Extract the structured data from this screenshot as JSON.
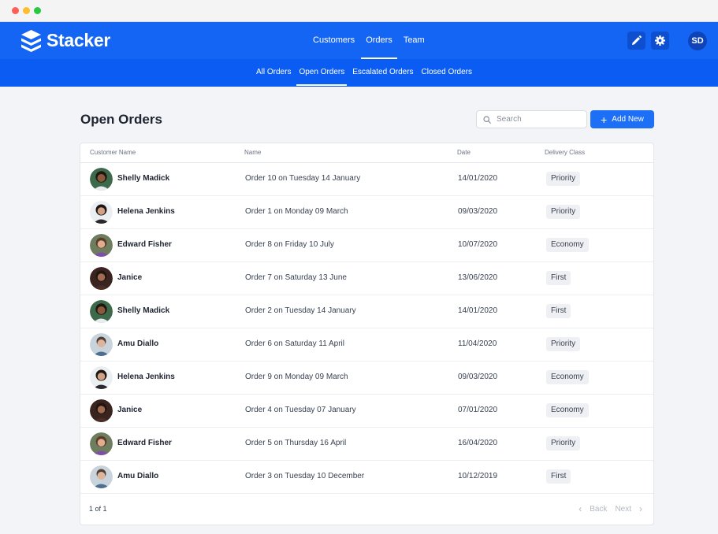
{
  "app": {
    "brand": "Stacker"
  },
  "topnav": [
    {
      "label": "Customers",
      "active": false
    },
    {
      "label": "Orders",
      "active": true
    },
    {
      "label": "Team",
      "active": false
    }
  ],
  "user": {
    "initials": "SD"
  },
  "subnav": [
    {
      "label": "All Orders",
      "active": false
    },
    {
      "label": "Open Orders",
      "active": true
    },
    {
      "label": "Escalated Orders",
      "active": false
    },
    {
      "label": "Closed Orders",
      "active": false
    }
  ],
  "page": {
    "title": "Open Orders"
  },
  "search": {
    "placeholder": "Search",
    "value": ""
  },
  "add_button": {
    "label": "Add New"
  },
  "table": {
    "columns": [
      "Customer Name",
      "Name",
      "Date",
      "Delivery Class"
    ],
    "rows": [
      {
        "customer": "Shelly Madick",
        "order": "Order 10 on Tuesday 14 January",
        "date": "14/01/2020",
        "delivery": "Priority"
      },
      {
        "customer": "Helena Jenkins",
        "order": "Order 1 on Monday 09 March",
        "date": "09/03/2020",
        "delivery": "Priority"
      },
      {
        "customer": "Edward Fisher",
        "order": "Order 8 on Friday 10 July",
        "date": "10/07/2020",
        "delivery": "Economy"
      },
      {
        "customer": "Janice",
        "order": "Order 7 on Saturday 13 June",
        "date": "13/06/2020",
        "delivery": "First"
      },
      {
        "customer": "Shelly Madick",
        "order": "Order 2 on Tuesday 14 January",
        "date": "14/01/2020",
        "delivery": "First"
      },
      {
        "customer": "Amu Diallo",
        "order": "Order 6 on Saturday 11 April",
        "date": "11/04/2020",
        "delivery": "Priority"
      },
      {
        "customer": "Helena Jenkins",
        "order": "Order 9 on Monday 09 March",
        "date": "09/03/2020",
        "delivery": "Economy"
      },
      {
        "customer": "Janice",
        "order": "Order 4 on Tuesday 07 January",
        "date": "07/01/2020",
        "delivery": "Economy"
      },
      {
        "customer": "Edward Fisher",
        "order": "Order 5 on Thursday 16 April",
        "date": "16/04/2020",
        "delivery": "Priority"
      },
      {
        "customer": "Amu Diallo",
        "order": "Order 3 on Tuesday 10 December",
        "date": "10/12/2019",
        "delivery": "First"
      }
    ]
  },
  "pagination": {
    "info": "1 of 1",
    "back": "Back",
    "next": "Next"
  },
  "icons": {
    "logo": "stacker-logo-icon",
    "edit": "pencil-icon",
    "settings": "gear-icon",
    "search": "search-icon",
    "add": "plus-icon",
    "prev": "chevron-left-icon",
    "next": "chevron-right-icon"
  },
  "colors": {
    "primary": "#1565f5",
    "subnav": "#0a5cf2",
    "button": "#1d6ff5",
    "background": "#f3f4f7"
  }
}
